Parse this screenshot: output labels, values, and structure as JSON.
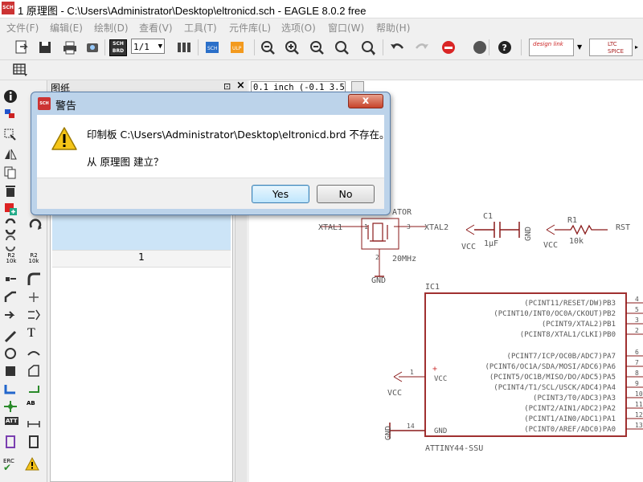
{
  "window": {
    "title": "1 原理图 - C:\\Users\\Administrator\\Desktop\\eltronicd.sch - EAGLE 8.0.2 free",
    "app_icon_text": "SCH"
  },
  "menu": [
    "文件(F)",
    "编辑(E)",
    "绘制(D)",
    "查看(V)",
    "工具(T)",
    "元件库(L)",
    "选项(O)",
    "窗口(W)",
    "帮助(H)"
  ],
  "toolbar": {
    "sheet_value": "1/1",
    "sch_brd_label": "SCH BRD",
    "design_link_label": "design link",
    "ltc_spice_label": "LTC SPICE"
  },
  "sheets_panel": {
    "title": "图纸",
    "pin_icon": "⊡",
    "close_icon": "×",
    "sheet_number": "1"
  },
  "canvas": {
    "coord_readout": "0.1 inch (-0.1 3.5)"
  },
  "schematic": {
    "resonator_label": "ATOR",
    "xtal1": "XTAL1",
    "xtal2": "XTAL2",
    "pin1": "1",
    "pin3": "3",
    "pin2": "2",
    "freq": "20MHz",
    "gnd": "GND",
    "c1": "C1",
    "c1_val": "1μF",
    "vcc": "VCC",
    "r1": "R1",
    "r1_val": "10k",
    "rst": "RST",
    "ic1": "IC1",
    "ic_name": "ATTINY44-SSU",
    "ic_vcc": "VCC",
    "ic_gnd": "GND",
    "vcc_pin": "1",
    "gnd_pin": "14",
    "ic_pins": [
      {
        "label": "(PCINT11/RESET/DW)PB3",
        "num": "4"
      },
      {
        "label": "(PCINT10/INT0/OC0A/CKOUT)PB2",
        "num": "5"
      },
      {
        "label": "(PCINT9/XTAL2)PB1",
        "num": "3"
      },
      {
        "label": "(PCINT8/XTAL1/CLKI)PB0",
        "num": "2"
      },
      {
        "label": "(PCINT7/ICP/OC0B/ADC7)PA7",
        "num": "6"
      },
      {
        "label": "(PCINT6/OC1A/SDA/MOSI/ADC6)PA6",
        "num": "7"
      },
      {
        "label": "(PCINT5/OC1B/MISO/DO/ADC5)PA5",
        "num": "8"
      },
      {
        "label": "(PCINT4/T1/SCL/USCK/ADC4)PA4",
        "num": "9"
      },
      {
        "label": "(PCINT3/T0/ADC3)PA3",
        "num": "10"
      },
      {
        "label": "(PCINT2/AIN1/ADC2)PA2",
        "num": "11"
      },
      {
        "label": "(PCINT1/AIN0/ADC1)PA1",
        "num": "12"
      },
      {
        "label": "(PCINT0/AREF/ADC0)PA0",
        "num": "13"
      }
    ]
  },
  "dialog": {
    "title": "警告",
    "close_label": "x",
    "message_line1": "印制板 C:\\Users\\Administrator\\Desktop\\eltronicd.brd 不存在。",
    "message_line2": "从 原理图 建立？",
    "yes_label": "Yes",
    "no_label": "No"
  },
  "left_tools": {
    "r2_label": "R2",
    "r2_sub": "10k",
    "ab_label": "AB",
    "erc_label": "ERC",
    "t_label": "T",
    "att_label": "ATT"
  },
  "colors": {
    "schematic_wire": "#8a1a1a",
    "ic_outline": "#a03030",
    "net_green": "#2a8a2a",
    "dialog_frame": "#bcd3ea",
    "sheet_select": "#cce4f7"
  }
}
